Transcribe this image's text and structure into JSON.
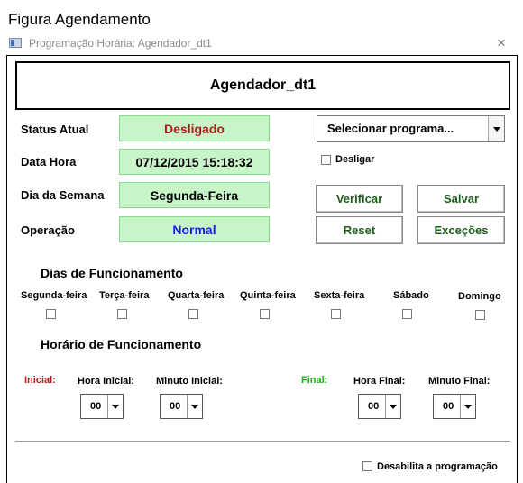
{
  "figure_caption": "Figura Agendamento",
  "window": {
    "title": "Programação Horária: Agendador_dt1",
    "close_symbol": "×"
  },
  "header": {
    "title": "Agendador_dt1"
  },
  "status": {
    "status_label": "Status Atual",
    "status_value": "Desligado",
    "datetime_label": "Data Hora",
    "datetime_value": "07/12/2015 15:18:32",
    "weekday_label": "Dia da Semana",
    "weekday_value": "Segunda-Feira",
    "operation_label": "Operação",
    "operation_value": "Normal"
  },
  "controls": {
    "program_select": "Selecionar programa...",
    "turn_off_label": "Desligar",
    "verify_button": "Verificar",
    "save_button": "Salvar",
    "reset_button": "Reset",
    "exceptions_button": "Exceções"
  },
  "days_section": {
    "title": "Dias de Funcionamento",
    "days": [
      "Segunda-feira",
      "Terça-feira",
      "Quarta-feira",
      "Quinta-feira",
      "Sexta-feira",
      "Sábado",
      "Domingo"
    ]
  },
  "hours_section": {
    "title": "Horário de Funcionamento",
    "start_label": "Inicial:",
    "start_hour_label": "Hora Inicial:",
    "start_minute_label": "Minuto Inicial:",
    "end_label": "Final:",
    "end_hour_label": "Hora Final:",
    "end_minute_label": "Minuto Final:",
    "start_hour": "00",
    "start_minute": "00",
    "end_hour": "00",
    "end_minute": "00"
  },
  "footer": {
    "disable_label": "Desabilita a programação"
  },
  "colors": {
    "field_bg": "#c8f5c8",
    "status_red": "#b01e1e",
    "normal_blue": "#1a1aff",
    "button_green": "#1c5e1c",
    "start_red": "#b01e1e",
    "end_green": "#22aa22"
  }
}
